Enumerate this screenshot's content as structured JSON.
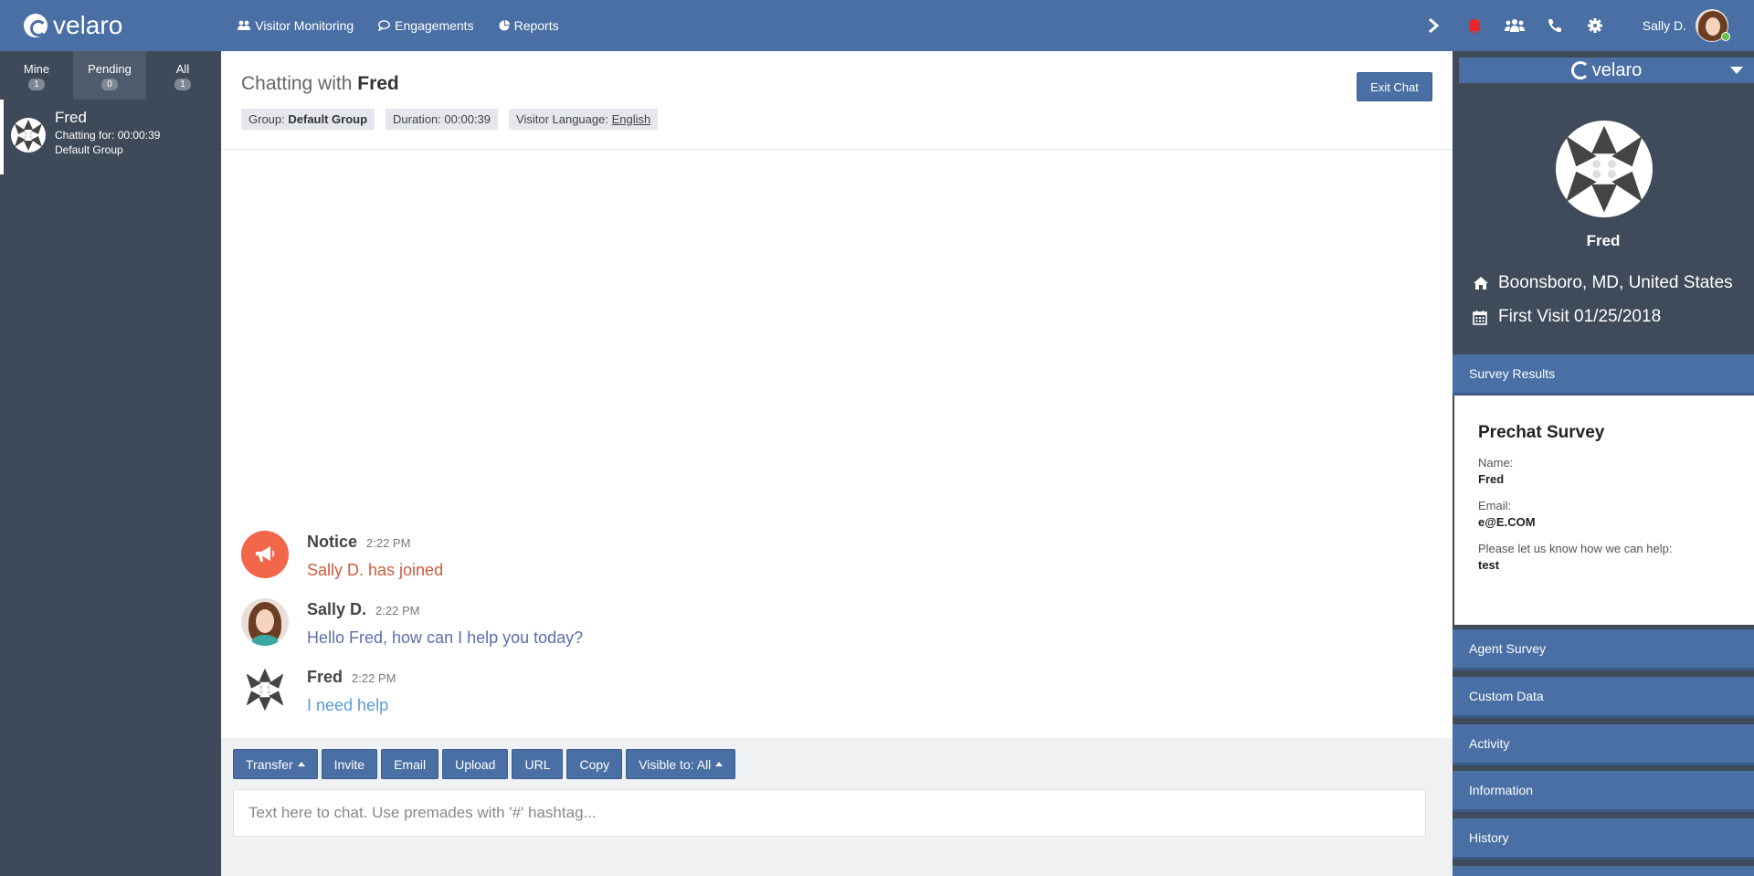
{
  "topbar": {
    "brand": "velaro",
    "nav": [
      {
        "icon": "users-icon",
        "label": "Visitor Monitoring"
      },
      {
        "icon": "chat-bubble-icon",
        "label": "Engagements"
      },
      {
        "icon": "pie-chart-icon",
        "label": "Reports"
      }
    ],
    "user_name": "Sally D."
  },
  "left": {
    "tabs": [
      {
        "label": "Mine",
        "count": "1"
      },
      {
        "label": "Pending",
        "count": "0"
      },
      {
        "label": "All",
        "count": "1"
      }
    ],
    "chat": {
      "name": "Fred",
      "duration": "Chatting for: 00:00:39",
      "group": "Default Group"
    }
  },
  "chat": {
    "title_prefix": "Chatting with",
    "title_name": "Fred",
    "group_label": "Group:",
    "group_value": "Default Group",
    "duration": "Duration: 00:00:39",
    "language_label": "Visitor Language:",
    "language_value": "English",
    "exit_label": "Exit Chat",
    "messages": [
      {
        "name": "Notice",
        "time": "2:22 PM",
        "text": "Sally D. has joined"
      },
      {
        "name": "Sally D.",
        "time": "2:22 PM",
        "text": "Hello Fred, how can I help you today?"
      },
      {
        "name": "Fred",
        "time": "2:22 PM",
        "text": "I need help"
      }
    ],
    "buttons": {
      "transfer": "Transfer",
      "invite": "Invite",
      "email": "Email",
      "upload": "Upload",
      "url": "URL",
      "copy": "Copy",
      "visible": "Visible to: All"
    },
    "input_placeholder": "Text here to chat. Use premades with '#' hashtag..."
  },
  "right": {
    "brand": "velaro",
    "visitor_name": "Fred",
    "location": "Boonsboro, MD, United States",
    "first_visit": "First Visit 01/25/2018",
    "survey_results_label": "Survey Results",
    "survey": {
      "title": "Prechat Survey",
      "q1": "Name:",
      "a1": "Fred",
      "q2": "Email:",
      "a2": "e@E.COM",
      "q3": "Please let us know how we can help:",
      "a3": "test"
    },
    "sections": [
      "Agent Survey",
      "Custom Data",
      "Activity",
      "Information",
      "History"
    ]
  },
  "colors": {
    "primary": "#4a6fa5",
    "sidebar": "#3e4959",
    "notice": "#f2664a",
    "bell": "#e8262a"
  }
}
